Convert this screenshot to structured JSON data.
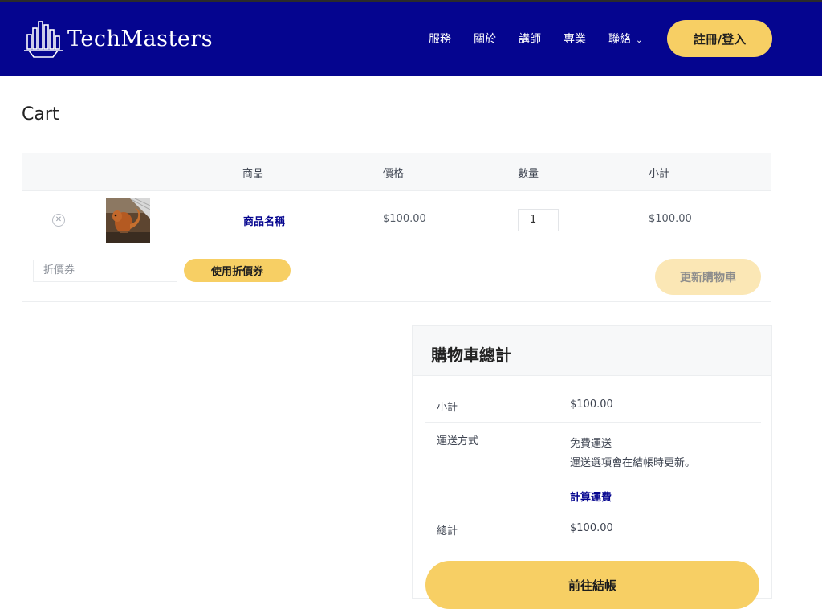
{
  "header": {
    "brand": "TechMasters",
    "nav": [
      {
        "label": "服務"
      },
      {
        "label": "關於"
      },
      {
        "label": "講師"
      },
      {
        "label": "專業"
      },
      {
        "label": "聯絡"
      }
    ],
    "login_label": "註冊/登入",
    "colors": {
      "bar": "#05058f",
      "accent": "#f7cf64"
    }
  },
  "page": {
    "title": "Cart"
  },
  "cart": {
    "headers": {
      "product": "商品",
      "price": "價格",
      "quantity": "數量",
      "subtotal": "小計"
    },
    "items": [
      {
        "name": "商品名稱",
        "price": "$100.00",
        "quantity": "1",
        "subtotal": "$100.00"
      }
    ],
    "coupon_placeholder": "折價券",
    "apply_coupon_label": "使用折價券",
    "update_cart_label": "更新購物車"
  },
  "totals": {
    "title": "購物車總計",
    "subtotal_label": "小計",
    "subtotal_value": "$100.00",
    "shipping_label": "運送方式",
    "shipping_value": "免費運送",
    "shipping_note": "運送選項會在結帳時更新。",
    "calc_shipping_link": "計算運費",
    "total_label": "總計",
    "total_value": "$100.00",
    "checkout_label": "前往結帳"
  }
}
